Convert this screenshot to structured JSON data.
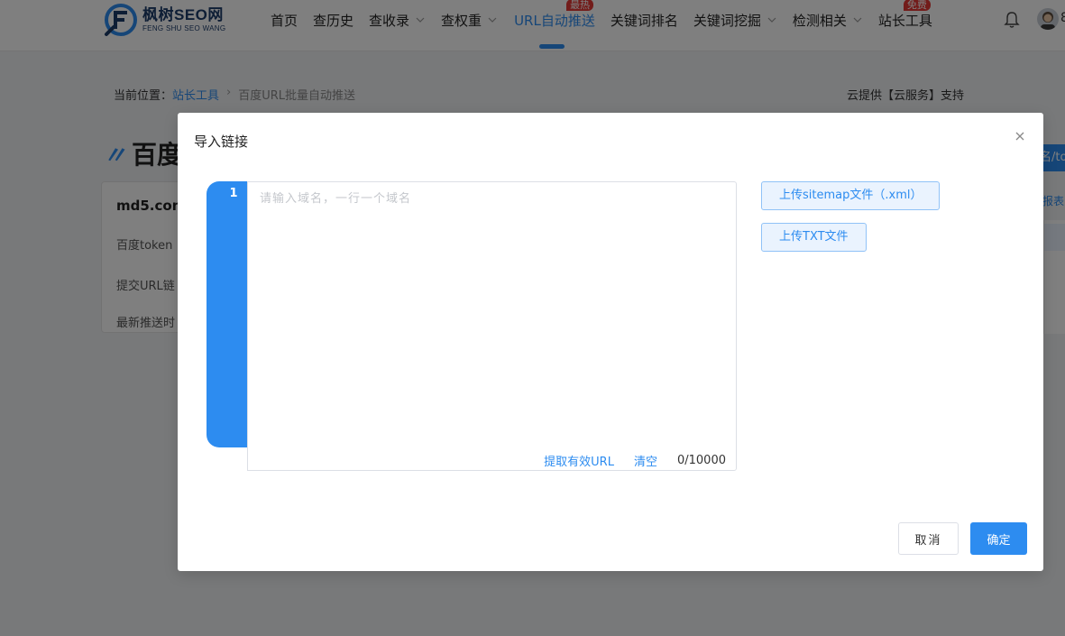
{
  "header": {
    "logo_cn": "枫树SEO网",
    "logo_en": "FENG SHU SEO WANG",
    "nav": [
      {
        "label": "首页"
      },
      {
        "label": "查历史"
      },
      {
        "label": "查收录",
        "dropdown": true
      },
      {
        "label": "查权重",
        "dropdown": true
      },
      {
        "label": "URL自动推送",
        "active": true,
        "badge": "最热"
      },
      {
        "label": "关键词排名"
      },
      {
        "label": "关键词挖掘",
        "dropdown": true
      },
      {
        "label": "检测相关",
        "dropdown": true
      },
      {
        "label": "站长工具",
        "badge": "免费"
      }
    ],
    "user_partial": "8"
  },
  "page": {
    "breadcrumb_prefix": "当前位置：",
    "breadcrumb_link": "站长工具",
    "breadcrumb_current": "百度URL批量自动推送",
    "cloud_note": "云提供【云服务】支持",
    "title": "百度U",
    "card": {
      "domain": "md5.com",
      "rows": [
        "百度token",
        "提交URL链",
        "最新推送时"
      ]
    },
    "side_button": "名/tok",
    "side_link": "报表"
  },
  "modal": {
    "title": "导入链接",
    "line_number": "1",
    "placeholder": "请输入域名，一行一个域名",
    "extract_label": "提取有效URL",
    "clear_label": "清空",
    "counter": "0/10000",
    "upload_sitemap": "上传sitemap文件（.xml）",
    "upload_txt": "上传TXT文件",
    "cancel_label": "取消",
    "ok_label": "确定"
  },
  "colors": {
    "primary": "#2d8cf0",
    "badge": "#e53935",
    "overlay": "rgba(0,0,0,0.5)"
  }
}
